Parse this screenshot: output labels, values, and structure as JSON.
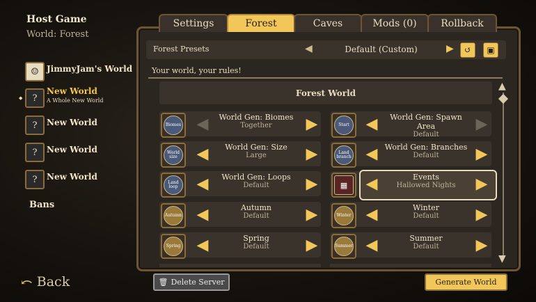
{
  "sidebar": {
    "title": "Host Game",
    "subtitle": "World: Forest",
    "worlds": [
      {
        "name": "JimmyJam's World",
        "sub": ""
      },
      {
        "name": "New World",
        "sub": "A Whole New World"
      },
      {
        "name": "New World",
        "sub": ""
      },
      {
        "name": "New World",
        "sub": ""
      },
      {
        "name": "New World",
        "sub": ""
      }
    ],
    "bans": "Bans",
    "back": "Back"
  },
  "tabs": [
    "Settings",
    "Forest",
    "Caves",
    "Mods (0)",
    "Rollback"
  ],
  "presets": {
    "label": "Forest Presets",
    "value": "Default (Custom)"
  },
  "motto": "Your world, your rules!",
  "section": "Forest World",
  "settings": [
    {
      "icon": "Biomes",
      "name": "World Gen: Biomes",
      "value": "Together"
    },
    {
      "icon": "Start",
      "name": "World Gen: Spawn Area",
      "value": "Default"
    },
    {
      "icon": "World size",
      "name": "World Gen: Size",
      "value": "Large"
    },
    {
      "icon": "Land branch",
      "name": "World Gen: Branches",
      "value": "Default"
    },
    {
      "icon": "Land loop",
      "name": "World Gen: Loops",
      "value": "Default"
    },
    {
      "icon": "",
      "name": "Events",
      "value": "Hallowed Nights"
    },
    {
      "icon": "Autumn",
      "name": "Autumn",
      "value": "Default"
    },
    {
      "icon": "Winter",
      "name": "Winter",
      "value": "Default"
    },
    {
      "icon": "Spring",
      "name": "Spring",
      "value": "Default"
    },
    {
      "icon": "Summer",
      "name": "Summer",
      "value": "Default"
    }
  ],
  "footer": {
    "delete": "Delete Server",
    "generate": "Generate World"
  },
  "colors": {
    "accent": "#f2c75a",
    "panel": "#2b2620",
    "border": "#6b5535"
  }
}
